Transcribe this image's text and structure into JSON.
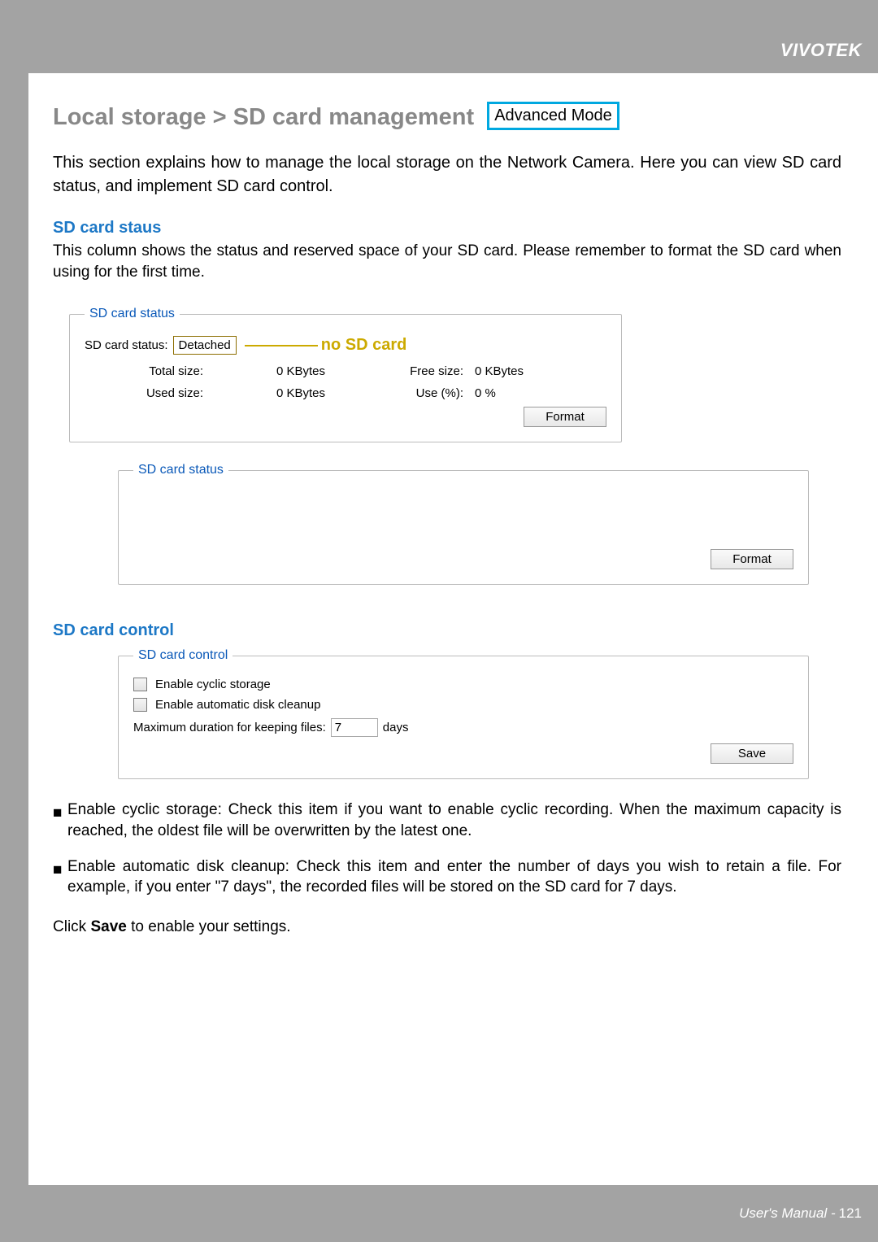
{
  "brand": "VIVOTEK",
  "h1": "Local storage > SD card management",
  "badge": "Advanced Mode",
  "intro": "This section explains how to manage the local storage on the Network Camera. Here you can view SD card status, and implement SD card control.",
  "sec1_title": "SD card staus",
  "sec1_desc": "This column shows the status and reserved space of your SD card. Please remember to format the SD card when using for the first time.",
  "status": {
    "legend": "SD card status",
    "status_label": "SD card status:",
    "status_value": "Detached",
    "callout": "no SD card",
    "rows": {
      "total_label": "Total size:",
      "total_value": "0  KBytes",
      "free_label": "Free size:",
      "free_value": "0  KBytes",
      "used_label": "Used size:",
      "used_value": "0  KBytes",
      "usepct_label": "Use (%):",
      "usepct_value": "0 %"
    },
    "format_btn": "Format"
  },
  "status2": {
    "legend": "SD card status",
    "format_btn": "Format"
  },
  "sec2_title": "SD card control",
  "control": {
    "legend": "SD card control",
    "cyclic_label": "Enable cyclic storage",
    "cleanup_label": "Enable automatic disk cleanup",
    "maxdur_label": "Maximum duration for keeping files:",
    "maxdur_value": "7",
    "maxdur_unit": "days",
    "save_btn": "Save"
  },
  "bullets": {
    "b1": "Enable cyclic storage: Check this item if you want to enable cyclic recording. When the maximum capacity is reached, the oldest file will be overwritten by the latest one.",
    "b2": "Enable automatic disk cleanup: Check this item and enter the number of days you wish to retain a file. For example, if you enter \"7 days\", the recorded files will be stored on the SD card for 7 days."
  },
  "final_pre": "Click ",
  "final_bold": "Save",
  "final_post": " to enable your settings.",
  "footer_text": "User's Manual - ",
  "footer_page": "121"
}
